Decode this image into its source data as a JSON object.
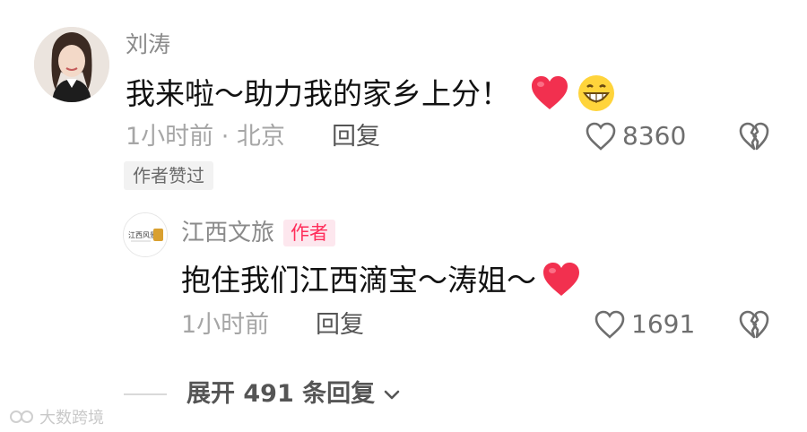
{
  "comment": {
    "username": "刘涛",
    "text": "我来啦～助力我的家乡上分！",
    "time_location": "1小时前 · 北京",
    "reply_label": "回复",
    "like_count": "8360",
    "author_liked_badge": "作者赞过"
  },
  "reply": {
    "username": "江西文旅",
    "author_tag": "作者",
    "text": "抱住我们江西滴宝～涛姐～",
    "time": "1小时前",
    "reply_label": "回复",
    "like_count": "1691"
  },
  "expand": {
    "label": "展开 491 条回复"
  },
  "watermark": {
    "text": "大数跨境"
  },
  "colors": {
    "heart": "#f2304f",
    "author_tag_text": "#ff2d5a",
    "author_tag_bg": "#fde7ee"
  }
}
